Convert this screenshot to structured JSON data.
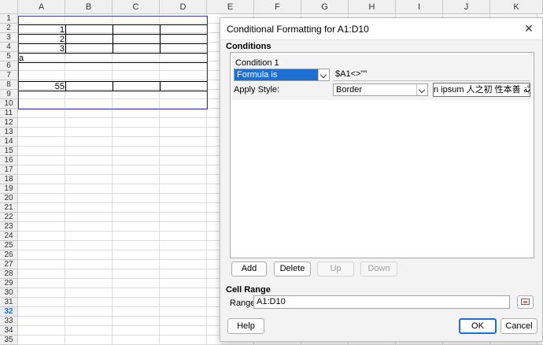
{
  "sheet": {
    "columns": [
      "A",
      "B",
      "C",
      "D",
      "E",
      "F",
      "G",
      "H",
      "I",
      "J",
      "K"
    ],
    "rows": [
      "1",
      "2",
      "3",
      "4",
      "5",
      "6",
      "7",
      "8",
      "9",
      "10",
      "11",
      "12",
      "13",
      "14",
      "15",
      "16",
      "17",
      "18",
      "19",
      "20",
      "21",
      "22",
      "23",
      "24",
      "25",
      "26",
      "27",
      "28",
      "29",
      "30",
      "31",
      "32",
      "33",
      "34",
      "35"
    ],
    "active_row": "32",
    "cells": {
      "A2": "1",
      "A3": "2",
      "A4": "3",
      "A5": "a",
      "A8": "55"
    }
  },
  "dialog": {
    "title": "Conditional Formatting for A1:D10",
    "close_icon": "close-icon",
    "conditions_heading": "Conditions",
    "condition_label": "Condition 1",
    "condition_type": "Formula is",
    "formula_value": "$A1<>\"\"",
    "apply_style_label": "Apply Style:",
    "apply_style_value": "Border",
    "preview_text": "n ipsum   人之初 性本善   ﻿يَّة",
    "buttons": {
      "add": "Add",
      "delete": "Delete",
      "up": "Up",
      "down": "Down",
      "help": "Help",
      "ok": "OK",
      "cancel": "Cancel"
    },
    "cell_range_heading": "Cell Range",
    "range_label": "Range:",
    "range_value": "A1:D10",
    "accent_color": "#1f6fd1"
  }
}
